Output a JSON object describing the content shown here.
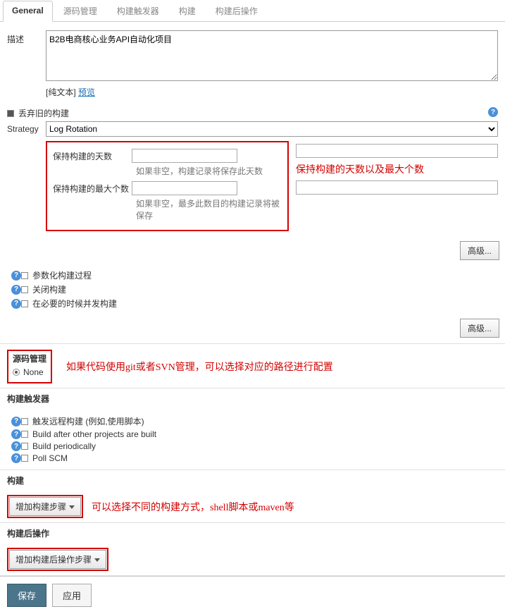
{
  "tabs": {
    "general": "General",
    "scm": "源码管理",
    "triggers": "构建触发器",
    "build": "构建",
    "post": "构建后操作"
  },
  "desc": {
    "label": "描述",
    "value": "B2B电商核心业务API自动化项目",
    "hint_prefix": "[纯文本] ",
    "preview": "预览"
  },
  "discard": {
    "label": "丢弃旧的构建",
    "strategy_label": "Strategy",
    "strategy_value": "Log Rotation",
    "days_label": "保持构建的天数",
    "days_help": "如果非空，构建记录将保存此天数",
    "max_label": "保持构建的最大个数",
    "max_help": "如果非空，最多此数目的构建记录将被保存",
    "annotation": "保持构建的天数以及最大个数"
  },
  "advanced": "高级...",
  "params": {
    "param_build": "参数化构建过程",
    "disable": "关闭构建",
    "concurrent": "在必要的时候并发构建"
  },
  "scm_section": {
    "title": "源码管理",
    "none": "None",
    "annotation": "如果代码使用git或者SVN管理，可以选择对应的路径进行配置"
  },
  "triggers_section": {
    "title": "构建触发器",
    "remote": "触发远程构建 (例如,使用脚本)",
    "after_projects": "Build after other projects are built",
    "periodic": "Build periodically",
    "poll": "Poll SCM"
  },
  "build_section": {
    "title": "构建",
    "add_step": "增加构建步骤",
    "annotation": "可以选择不同的构建方式，shell脚本或maven等"
  },
  "post_section": {
    "title": "构建后操作",
    "add_post": "增加构建后操作步骤"
  },
  "footer": {
    "save": "保存",
    "apply": "应用"
  }
}
